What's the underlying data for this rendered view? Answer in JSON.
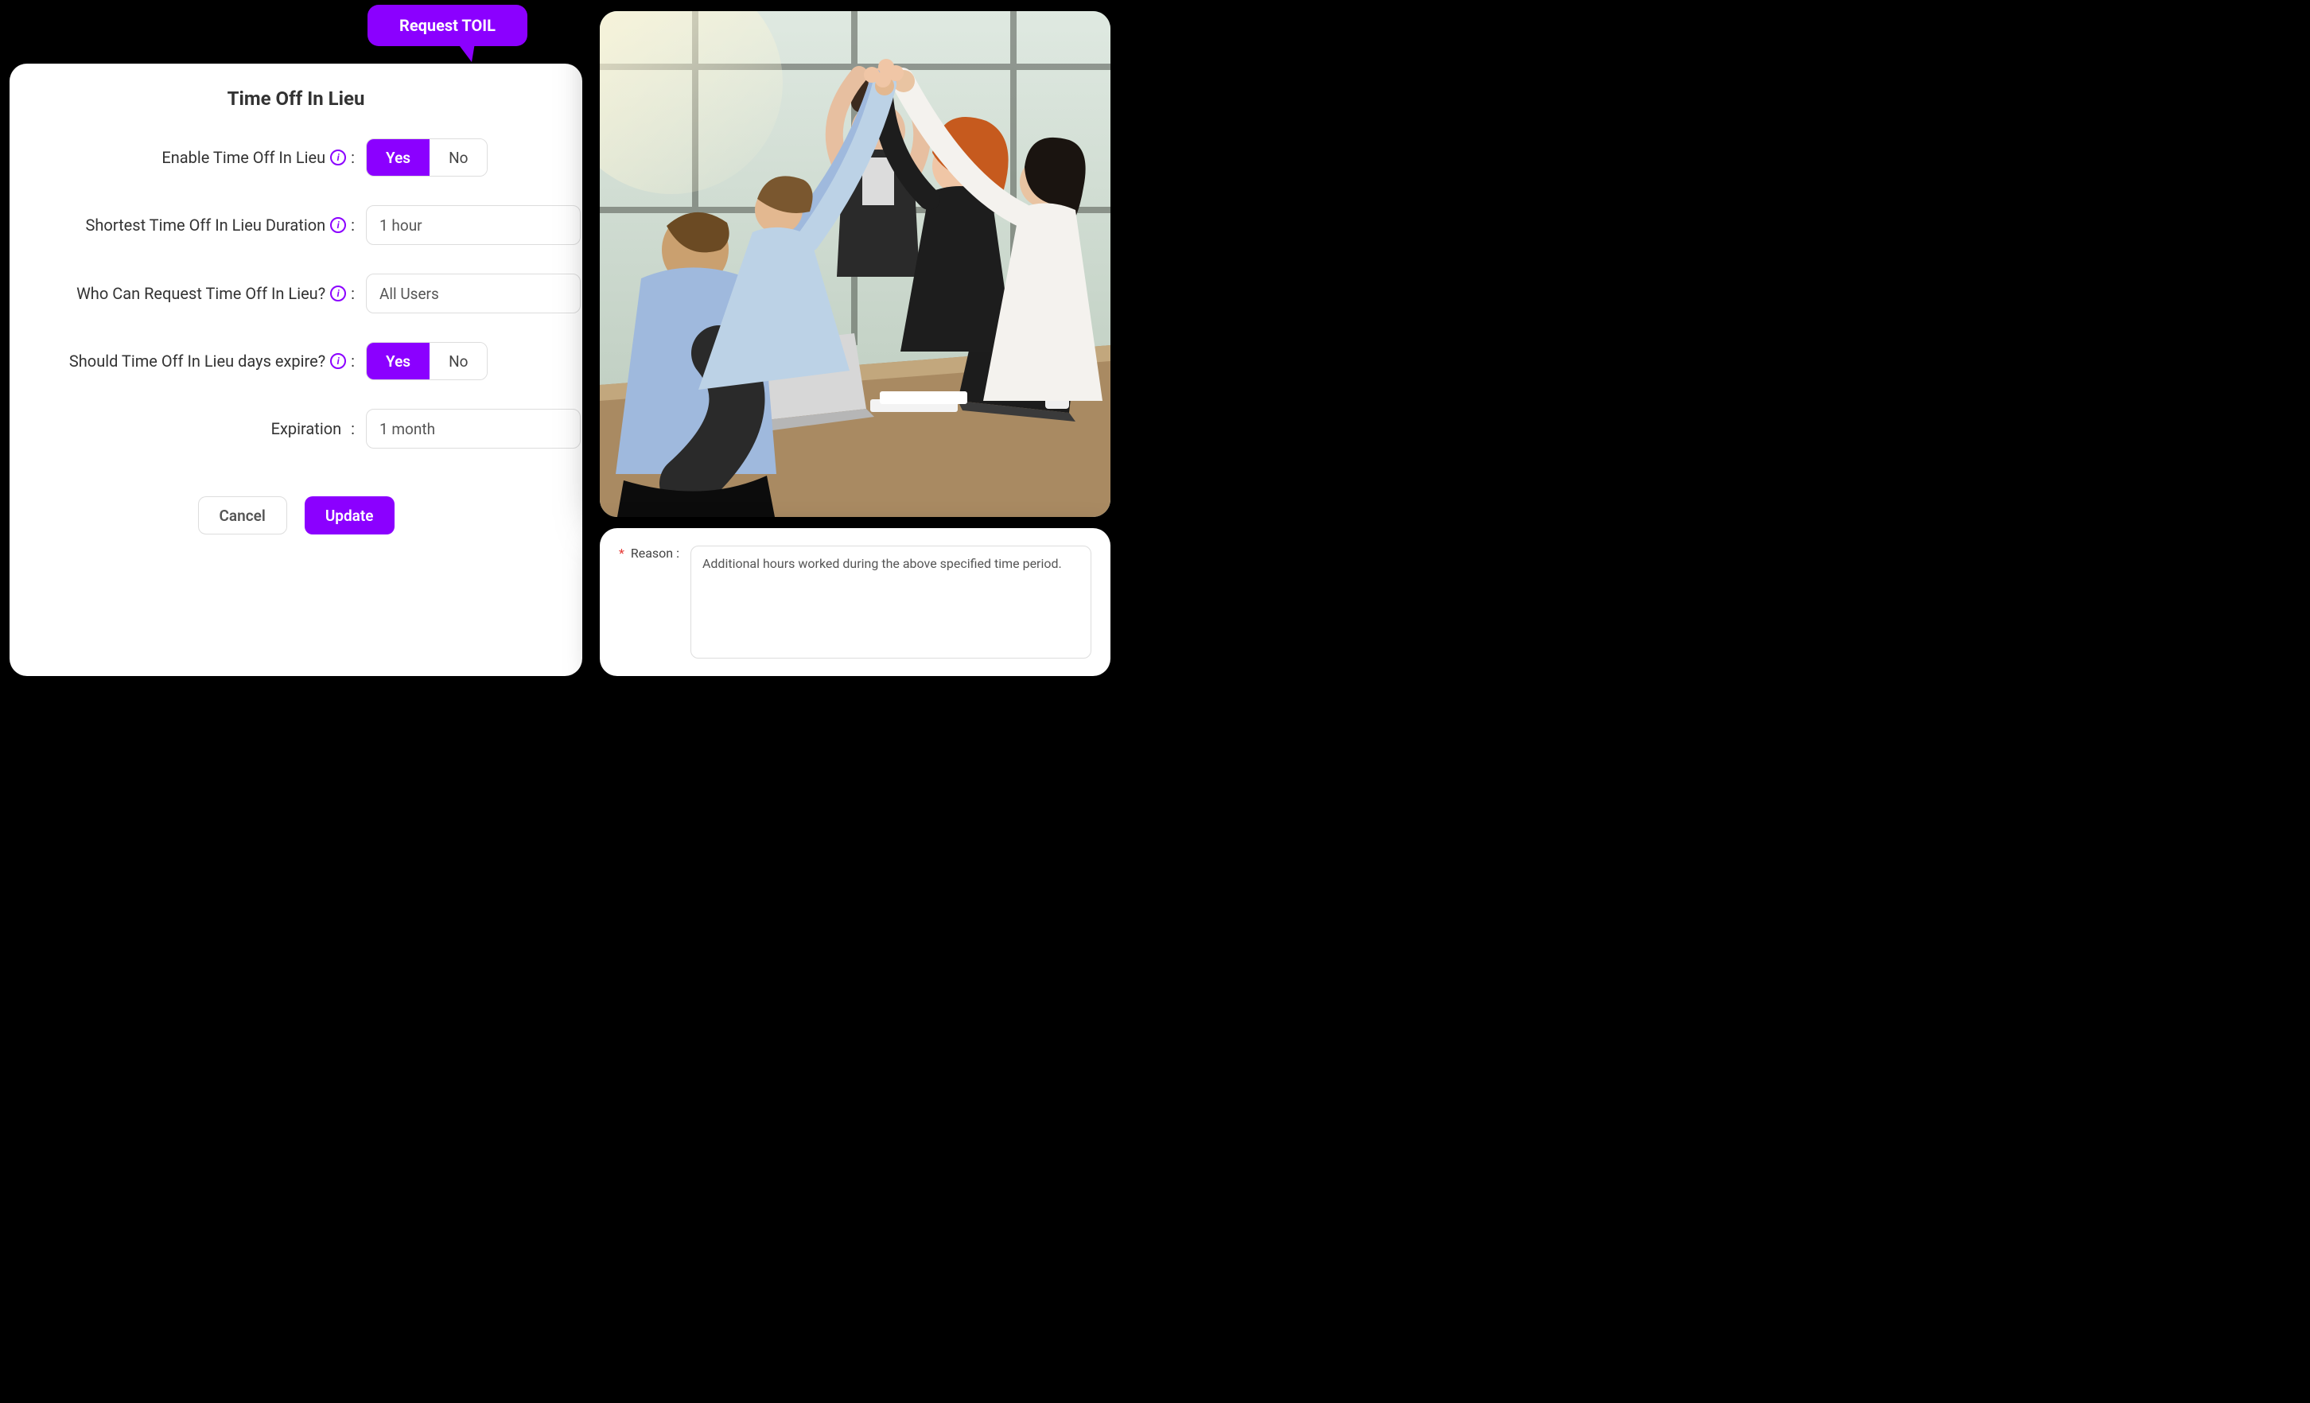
{
  "colors": {
    "accent": "#8b00ff"
  },
  "callout": {
    "label": "Request TOIL"
  },
  "settings": {
    "title": "Time Off In Lieu",
    "rows": {
      "enable": {
        "label": "Enable Time Off In Lieu",
        "has_info": true,
        "yes": "Yes",
        "no": "No",
        "value": "Yes"
      },
      "shortest": {
        "label": "Shortest Time Off In Lieu Duration",
        "has_info": true,
        "value": "1 hour"
      },
      "who": {
        "label": "Who Can Request Time Off In Lieu?",
        "has_info": true,
        "value": "All Users"
      },
      "expire": {
        "label": "Should Time Off In Lieu days expire?",
        "has_info": true,
        "yes": "Yes",
        "no": "No",
        "value": "Yes"
      },
      "expiration": {
        "label": "Expiration",
        "has_info": false,
        "value": "1 month"
      }
    },
    "actions": {
      "cancel": "Cancel",
      "update": "Update"
    }
  },
  "reason": {
    "required_mark": "*",
    "label": "Reason :",
    "value": "Additional hours worked during the above specified time period."
  }
}
